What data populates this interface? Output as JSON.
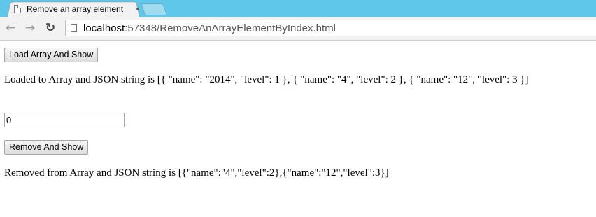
{
  "browser": {
    "tab_title": "Remove an array element",
    "tab_close": "×",
    "url_host": "localhost",
    "url_rest": ":57348/RemoveAnArrayElementByIndex.html",
    "back_glyph": "←",
    "forward_glyph": "→",
    "reload_glyph": "↻"
  },
  "page": {
    "load_button_label": "Load Array And Show",
    "loaded_text": "Loaded to Array and JSON string is [{ \"name\": \"2014\", \"level\": 1 }, { \"name\": \"4\", \"level\": 2 }, { \"name\": \"12\", \"level\": 3 }]",
    "index_value": "0",
    "remove_button_label": "Remove And Show",
    "removed_text": "Removed from Array and JSON string is [{\"name\":\"4\",\"level\":2},{\"name\":\"12\",\"level\":3}]"
  },
  "icons": {
    "tab_page": "page-icon",
    "omnibox_page": "page-icon",
    "back": "back-arrow-icon",
    "forward": "forward-arrow-icon",
    "reload": "reload-icon"
  }
}
